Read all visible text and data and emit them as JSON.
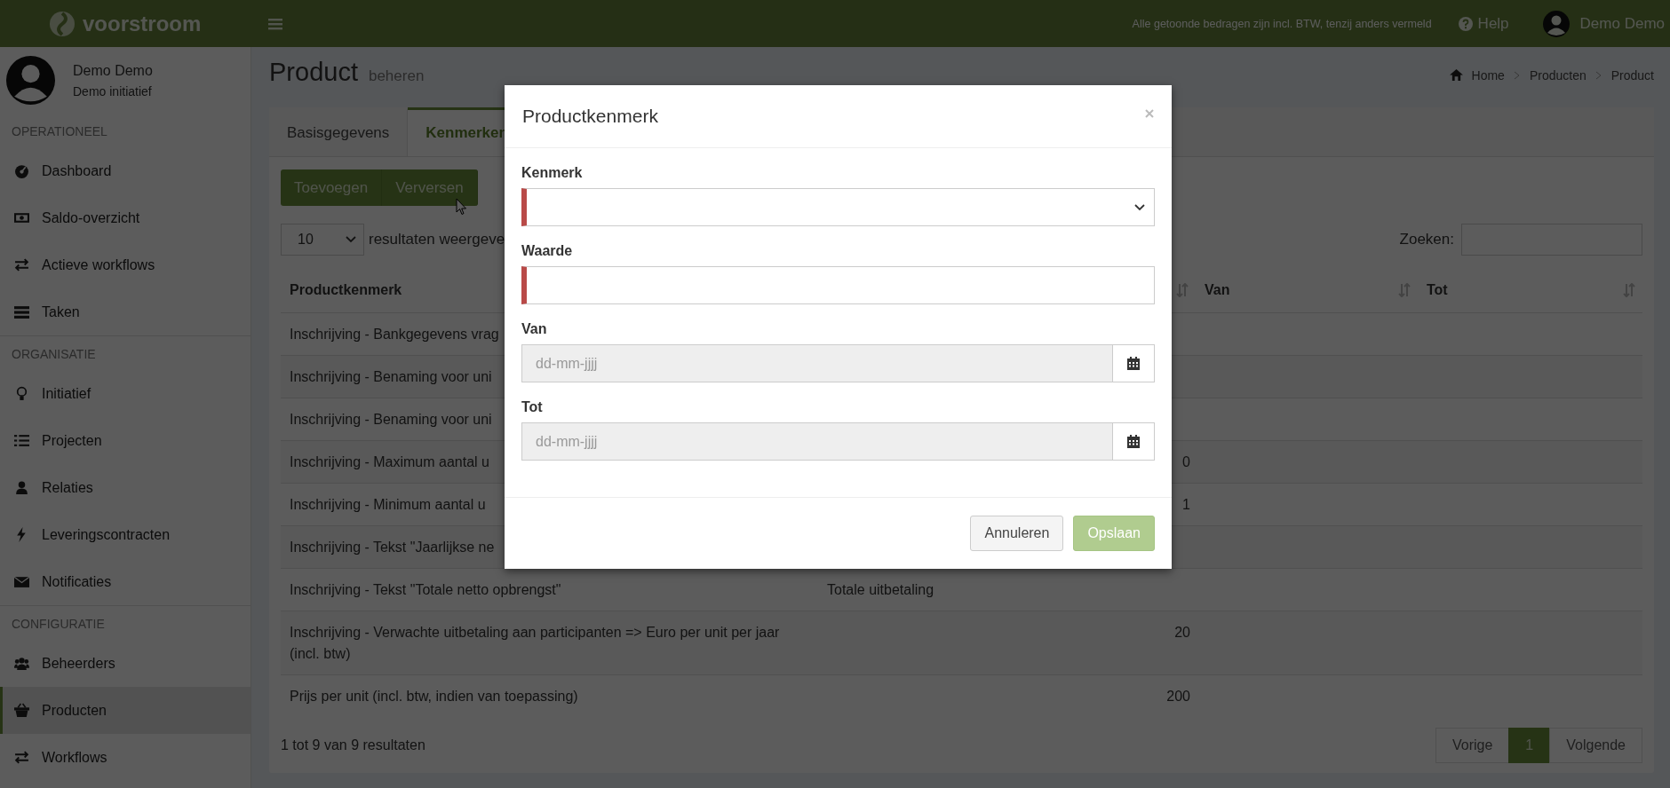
{
  "topbar": {
    "brand": "voorstroom",
    "notice": "Alle getoonde bedragen zijn incl. BTW, tenzij anders vermeld",
    "help": "Help",
    "user": "Demo Demo"
  },
  "sidebar": {
    "user_name": "Demo Demo",
    "user_org": "Demo initiatief",
    "sections": [
      {
        "title": "OPERATIONEEL",
        "items": [
          {
            "label": "Dashboard",
            "kind": "dashboard",
            "selected": false
          },
          {
            "label": "Saldo-overzicht",
            "kind": "money",
            "selected": false
          },
          {
            "label": "Actieve workflows",
            "kind": "exchange",
            "selected": false
          },
          {
            "label": "Taken",
            "kind": "tasks",
            "selected": false
          }
        ]
      },
      {
        "title": "ORGANISATIE",
        "items": [
          {
            "label": "Initiatief",
            "kind": "bulb",
            "selected": false
          },
          {
            "label": "Projecten",
            "kind": "list",
            "selected": false
          },
          {
            "label": "Relaties",
            "kind": "user",
            "selected": false
          },
          {
            "label": "Leveringscontracten",
            "kind": "bolt",
            "selected": false
          },
          {
            "label": "Notificaties",
            "kind": "envelope",
            "selected": false
          }
        ]
      },
      {
        "title": "CONFIGURATIE",
        "items": [
          {
            "label": "Beheerders",
            "kind": "users",
            "selected": false
          },
          {
            "label": "Producten",
            "kind": "basket",
            "selected": true
          },
          {
            "label": "Workflows",
            "kind": "exchange",
            "selected": false
          }
        ]
      }
    ]
  },
  "page": {
    "title": "Product",
    "subtitle": "beheren",
    "breadcrumb": [
      "Home",
      "Producten",
      "Product"
    ]
  },
  "tabs": [
    {
      "label": "Basisgegevens",
      "selected": false
    },
    {
      "label": "Kenmerken",
      "selected": true
    }
  ],
  "toolbar": [
    "Toevoegen",
    "Verversen"
  ],
  "length_select": {
    "value": "10",
    "label": "resultaten weergeve"
  },
  "search": {
    "label": "Zoeken:"
  },
  "table": {
    "columns": [
      {
        "label": "Productkenmerk"
      },
      {},
      {
        "sort_icon": true
      },
      {
        "label": "Van",
        "sort_icon": true
      },
      {
        "label": "Tot",
        "sort_icon": true
      }
    ],
    "rows": [
      {
        "cells": [
          "Inschrijving - Bankgegevens vrag"
        ]
      },
      {
        "cells": [
          "Inschrijving - Benaming voor uni"
        ]
      },
      {
        "cells": [
          "Inschrijving - Benaming voor uni"
        ]
      },
      {
        "cells": [
          "Inschrijving - Maximum aantal u",
          "",
          "0"
        ]
      },
      {
        "cells": [
          "Inschrijving - Minimum aantal u",
          "",
          "1"
        ]
      },
      {
        "cells": [
          "Inschrijving - Tekst \"Jaarlijkse ne"
        ]
      },
      {
        "cells": [
          "Inschrijving - Tekst \"Totale netto opbrengst\"",
          "Totale uitbetaling"
        ]
      },
      {
        "cells": [
          "Inschrijving - Verwachte uitbetaling aan participanten => Euro per unit per jaar (incl. btw)",
          "",
          "20"
        ]
      },
      {
        "cells": [
          "Prijs per unit (incl. btw, indien van toepassing)",
          "",
          "200"
        ]
      }
    ],
    "info": "1 tot 9 van 9 resultaten"
  },
  "pagination": [
    {
      "label": "Vorige",
      "selected": false
    },
    {
      "label": "1",
      "selected": true
    },
    {
      "label": "Volgende",
      "selected": false
    }
  ],
  "modal": {
    "title": "Productkenmerk",
    "fields": [
      {
        "label": "Kenmerk",
        "kind": "select",
        "required": true
      },
      {
        "label": "Waarde",
        "kind": "text",
        "required": true
      },
      {
        "label": "Van",
        "kind": "date",
        "required": false,
        "placeholder": "dd-mm-jjjj"
      },
      {
        "label": "Tot",
        "kind": "date",
        "required": false,
        "placeholder": "dd-mm-jjjj"
      }
    ],
    "buttons": [
      {
        "label": "Annuleren",
        "kind": "default",
        "disabled": false
      },
      {
        "label": "Opslaan",
        "kind": "primary",
        "disabled": true
      }
    ]
  }
}
